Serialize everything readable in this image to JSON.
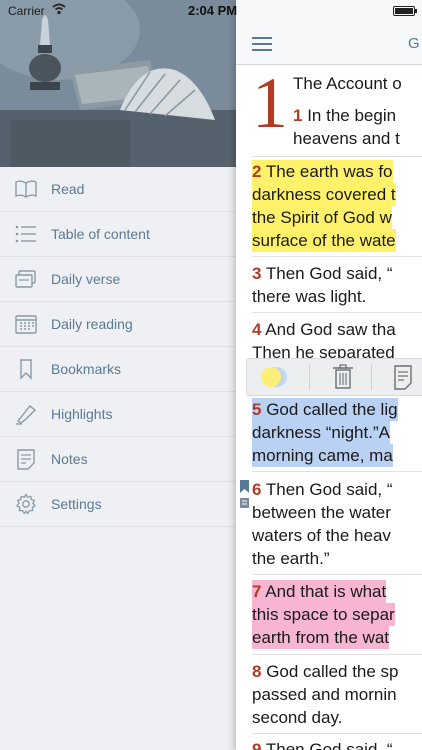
{
  "status_bar": {
    "carrier": "Carrier",
    "time": "2:04 PM"
  },
  "menu": {
    "items": [
      {
        "label": "Read",
        "icon": "open-book-icon"
      },
      {
        "label": "Table of content",
        "icon": "list-icon"
      },
      {
        "label": "Daily verse",
        "icon": "cards-icon"
      },
      {
        "label": "Daily reading",
        "icon": "calendar-icon"
      },
      {
        "label": "Bookmarks",
        "icon": "bookmark-icon"
      },
      {
        "label": "Highlights",
        "icon": "highlighter-icon"
      },
      {
        "label": "Notes",
        "icon": "notes-icon"
      },
      {
        "label": "Settings",
        "icon": "gear-icon"
      }
    ]
  },
  "reader": {
    "title": "G",
    "chapter": "1",
    "heading": "The Account o",
    "verses": [
      {
        "num": "1",
        "lines": [
          "In the begin",
          "heavens and t"
        ],
        "highlight": "none"
      },
      {
        "num": "2",
        "lines": [
          "The earth was fo",
          "darkness covered t",
          "the Spirit of God w",
          "surface of the wate"
        ],
        "highlight": "yellow"
      },
      {
        "num": "3",
        "lines": [
          "Then God said, “",
          "there was light."
        ],
        "highlight": "none"
      },
      {
        "num": "4",
        "lines": [
          "And God saw tha",
          "Then he separated"
        ],
        "highlight": "none"
      },
      {
        "num": "5",
        "lines": [
          "God called the lig",
          "darkness “night.”A",
          "morning came, ma"
        ],
        "highlight": "blue"
      },
      {
        "num": "6",
        "lines": [
          "Then God said, “",
          "between the water",
          "waters of the heav",
          "the earth.”"
        ],
        "highlight": "none"
      },
      {
        "num": "7",
        "lines": [
          "And that is what",
          "this space to separ",
          "earth from the wat"
        ],
        "highlight": "pink"
      },
      {
        "num": "8",
        "lines": [
          "God called the sp",
          "passed and mornin",
          "second day."
        ],
        "highlight": "none"
      },
      {
        "num": "9",
        "lines": [
          "Then God said, “"
        ],
        "highlight": "none"
      }
    ]
  },
  "colors": {
    "accent": "#5a7995",
    "verse_number": "#b33a25",
    "highlight_yellow": "#fff26a",
    "highlight_blue": "#b9d2f3",
    "highlight_pink": "#f7b4d3"
  }
}
